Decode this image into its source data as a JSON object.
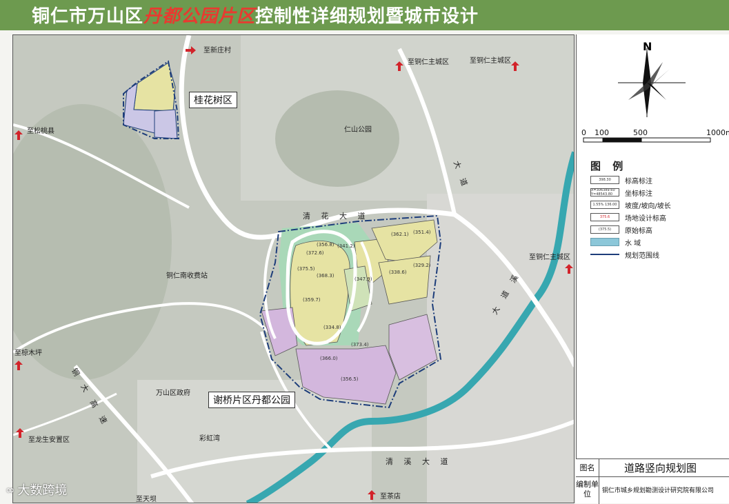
{
  "title": {
    "prefix": "铜仁市万山区",
    "highlight": "丹都公园片区",
    "suffix": "控制性详细规划暨城市设计"
  },
  "map": {
    "districts": {
      "guihuashu": "桂花树区",
      "xieqiao": "谢桥片区丹都公园"
    },
    "destinations": {
      "xinzhuang": "至新庄村",
      "tongren_main_1": "至铜仁主城区",
      "tongren_main_2": "至铜仁主城区",
      "tongren_main_3": "至铜仁主城区",
      "songtao": "至松桃县",
      "mumuping": "至椋木坪",
      "longsheng": "至龙生安置区",
      "chadian": "至茶店",
      "tianba": "至天坝"
    },
    "places": {
      "renshan_park": "仁山公园",
      "toll_station": "铜仁南收费站",
      "wanshan": "万山区政府",
      "caihong": "彩虹湾"
    },
    "roads": {
      "north": "清 花 大 道",
      "east": "大 道",
      "south": "清 溪 大 道",
      "river": "大 道 溪",
      "west_road": "铜 大 高 速"
    },
    "elevations": [
      "(372.6)",
      "(356.8)",
      "(341.2)",
      "(375.5)",
      "(368.3)",
      "(359.7)",
      "(334.8)",
      "(347.9)",
      "(362.1)",
      "(351.4)",
      "(338.6)",
      "(329.2)",
      "(366.0)",
      "(373.4)",
      "(356.5)"
    ]
  },
  "compass": {
    "north_label": "N"
  },
  "scale": {
    "labels": [
      "0",
      "100",
      "500",
      "1000m"
    ]
  },
  "legend": {
    "title": "图 例",
    "items": [
      {
        "symbol": "398.30",
        "label": "标高标注"
      },
      {
        "symbol": "X=306389.60 Y=48543.80",
        "label": "坐标标注"
      },
      {
        "symbol": "1.55% 136.00",
        "label": "坡度/坡向/坡长"
      },
      {
        "symbol": "375.6",
        "label": "场地设计标高"
      },
      {
        "symbol": "(375.5)",
        "label": "原始标高"
      },
      {
        "symbol": "",
        "label": "水 域"
      },
      {
        "symbol": "",
        "label": "规划范围线"
      }
    ]
  },
  "info_table": {
    "drawing_name_key": "图名",
    "drawing_name": "道路竖向规划图",
    "unit_key": "编制单位",
    "unit": "铜仁市城乡规划勘测设计研究院有限公司"
  },
  "watermark": "大数跨境",
  "colors": {
    "title_bg": "#6d9a4f",
    "highlight": "#e83a30",
    "water": "#37a7b0",
    "parcel_yellow": "#e6e3a3",
    "parcel_purple": "#d3b7dd",
    "parcel_green": "#a9d8b8",
    "boundary": "#1d3d7a"
  }
}
